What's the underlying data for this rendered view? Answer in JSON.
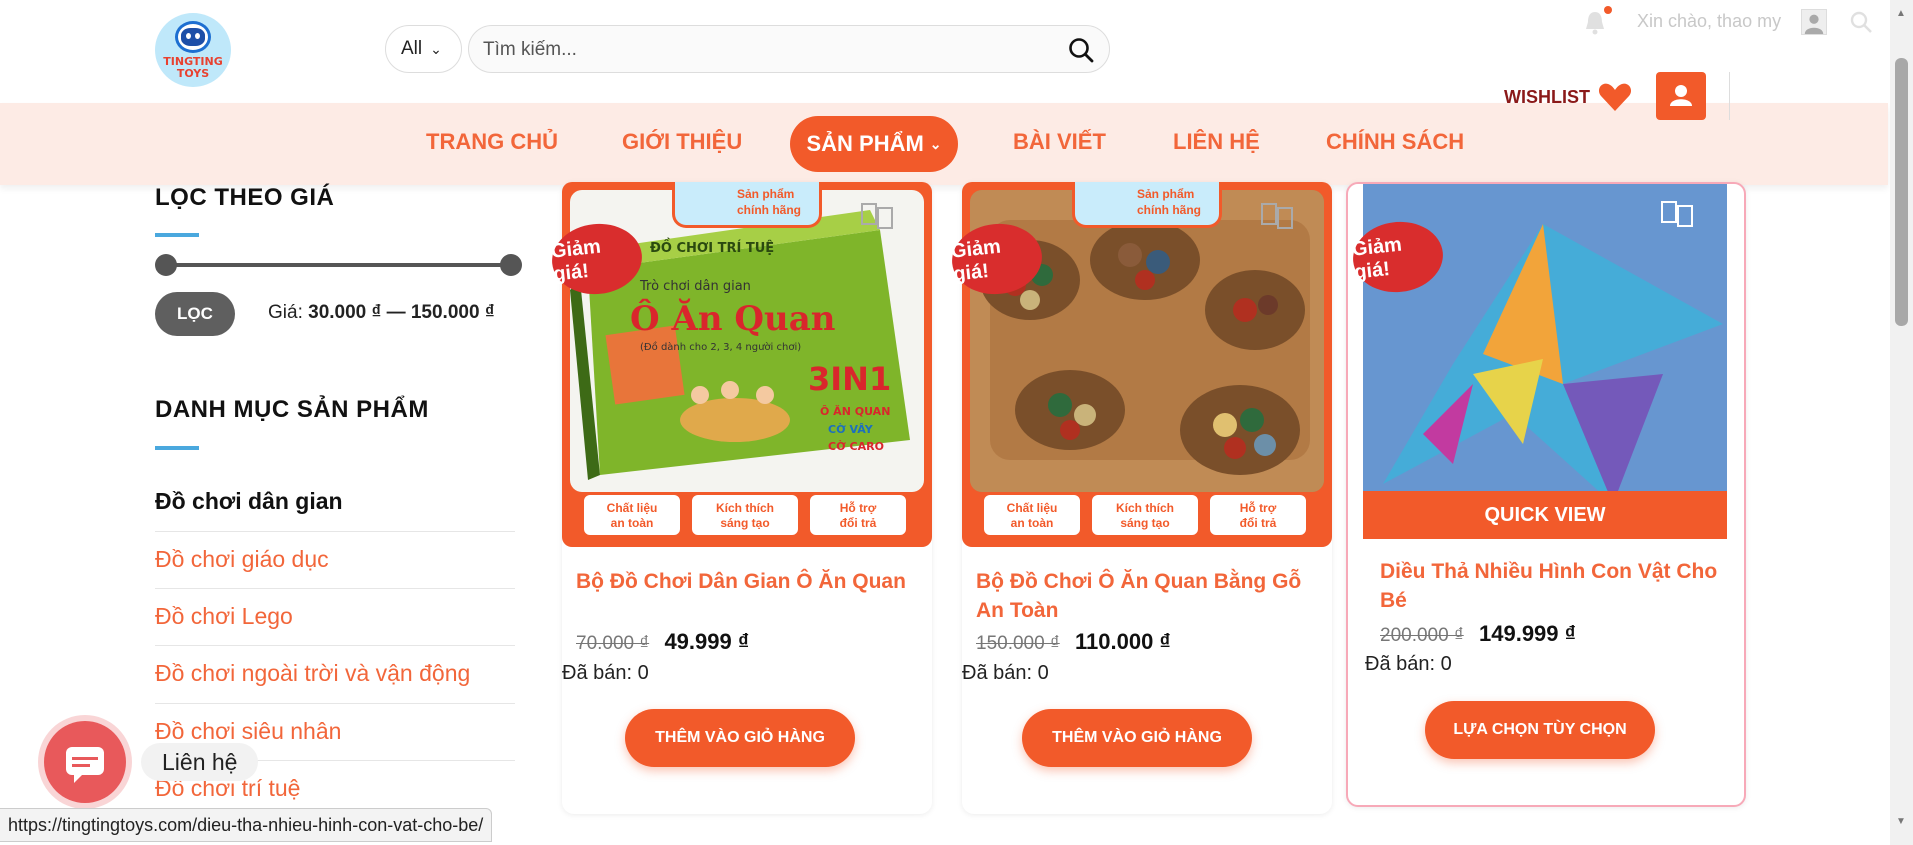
{
  "header": {
    "logo_text_line1": "TINGTING",
    "logo_text_line2": "TOYS",
    "category_select": "All",
    "search_placeholder": "Tìm kiếm...",
    "greeting": "Xin chào, thao my",
    "wishlist_label": "WISHLIST"
  },
  "nav": {
    "items": [
      "TRANG CHỦ",
      "GIỚI THIỆU",
      "SẢN PHẨM",
      "BÀI VIẾT",
      "LIÊN HỆ",
      "CHÍNH SÁCH"
    ],
    "active": "SẢN PHẨM"
  },
  "sidebar": {
    "price_filter_title": "LỌC THEO GIÁ",
    "filter_button": "LỌC",
    "price_label": "Giá:",
    "price_min": "30.000 ₫",
    "price_sep": "—",
    "price_max": "150.000 ₫",
    "categories_title": "DANH MỤC SẢN PHẨM",
    "categories": [
      "Đồ chơi dân gian",
      "Đồ chơi giáo dục",
      "Đồ chơi Lego",
      "Đồ chơi ngoài trời và vận động",
      "Đồ chơi siêu nhân",
      "Đồ chơi trí tuệ"
    ]
  },
  "sticker": {
    "line1": "Sản phẩm",
    "line2": "chính hãng",
    "badge1_line1": "Chất liệu",
    "badge1_line2": "an toàn",
    "badge2_line1": "Kích thích",
    "badge2_line2": "sáng tạo",
    "badge3_line1": "Hỗ trợ",
    "badge3_line2": "đổi trả"
  },
  "box_art": {
    "header": "ĐỒ CHƠI TRÍ TUỆ",
    "subtitle": "Trò chơi dân gian",
    "title": "Ô Ăn Quan",
    "players": "(Đồ dành cho 2, 3, 4 người chơi)",
    "big": "3IN1",
    "list1": "Ô ĂN QUAN",
    "list2": "CỜ VÂY",
    "list3": "CỜ CARO"
  },
  "products": [
    {
      "sale_badge": "Giảm giá!",
      "title": "Bộ Đồ Chơi Dân Gian Ô Ăn Quan",
      "old_price": "70.000 ₫",
      "new_price": "49.999 ₫",
      "sold": "Đã bán: 0",
      "button": "THÊM VÀO GIỎ HÀNG"
    },
    {
      "sale_badge": "Giảm giá!",
      "title": "Bộ Đồ Chơi Ô Ăn Quan Bằng Gỗ An Toàn",
      "old_price": "150.000 ₫",
      "new_price": "110.000 ₫",
      "sold": "Đã bán: 0",
      "button": "THÊM VÀO GIỎ HÀNG"
    },
    {
      "sale_badge": "Giảm giá!",
      "title": "Diều Thả Nhiều Hình Con Vật Cho Bé",
      "old_price": "200.000 ₫",
      "new_price": "149.999 ₫",
      "sold": "Đã bán: 0",
      "button": "LỰA CHỌN TÙY CHỌN",
      "quick_view": "QUICK VIEW"
    }
  ],
  "contact": {
    "label": "Liên hệ"
  },
  "status_url": "https://tingtingtoys.com/dieu-tha-nhieu-hinh-con-vat-cho-be/",
  "colors": {
    "accent": "#f25a2a",
    "nav_bg": "#fdebe5",
    "sale": "#d92d2d"
  }
}
